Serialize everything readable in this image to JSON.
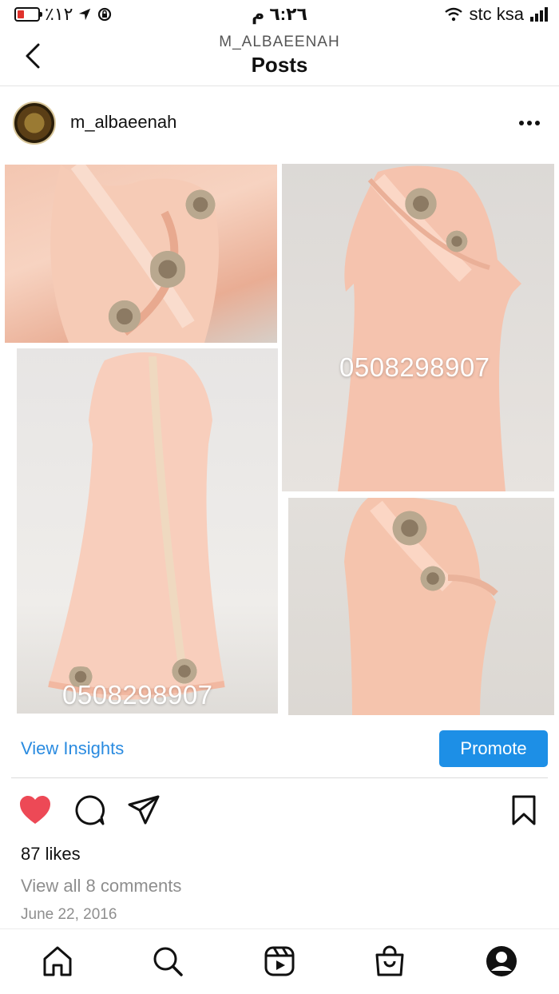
{
  "status_bar": {
    "battery_text": "٪١٢",
    "time": "٦:٢٦ م",
    "carrier": "stc ksa",
    "icons": [
      "battery-charging-icon",
      "location-arrow-icon",
      "rotation-lock-icon",
      "wifi-icon",
      "signal-icon"
    ]
  },
  "header": {
    "subtitle": "M_ALBAEENAH",
    "title": "Posts",
    "back_icon": "chevron-left-icon"
  },
  "post": {
    "username": "m_albaeenah",
    "more_icon": "ellipsis-icon",
    "image_overlay_text": [
      "0508298907",
      "0508298907"
    ],
    "view_insights": "View Insights",
    "promote": "Promote",
    "like_icon": "heart-filled-icon",
    "comment_icon": "comment-icon",
    "share_icon": "send-icon",
    "save_icon": "bookmark-icon",
    "likes": "87 likes",
    "view_comments": "View all 8 comments",
    "date": "June 22, 2016"
  },
  "tab_bar": {
    "items": [
      "home-icon",
      "search-icon",
      "reels-icon",
      "shop-icon",
      "profile-icon"
    ]
  },
  "colors": {
    "accent": "#1d8fe6",
    "link": "#2a8be0",
    "like": "#ed4956",
    "muted": "#8e8e8e"
  }
}
